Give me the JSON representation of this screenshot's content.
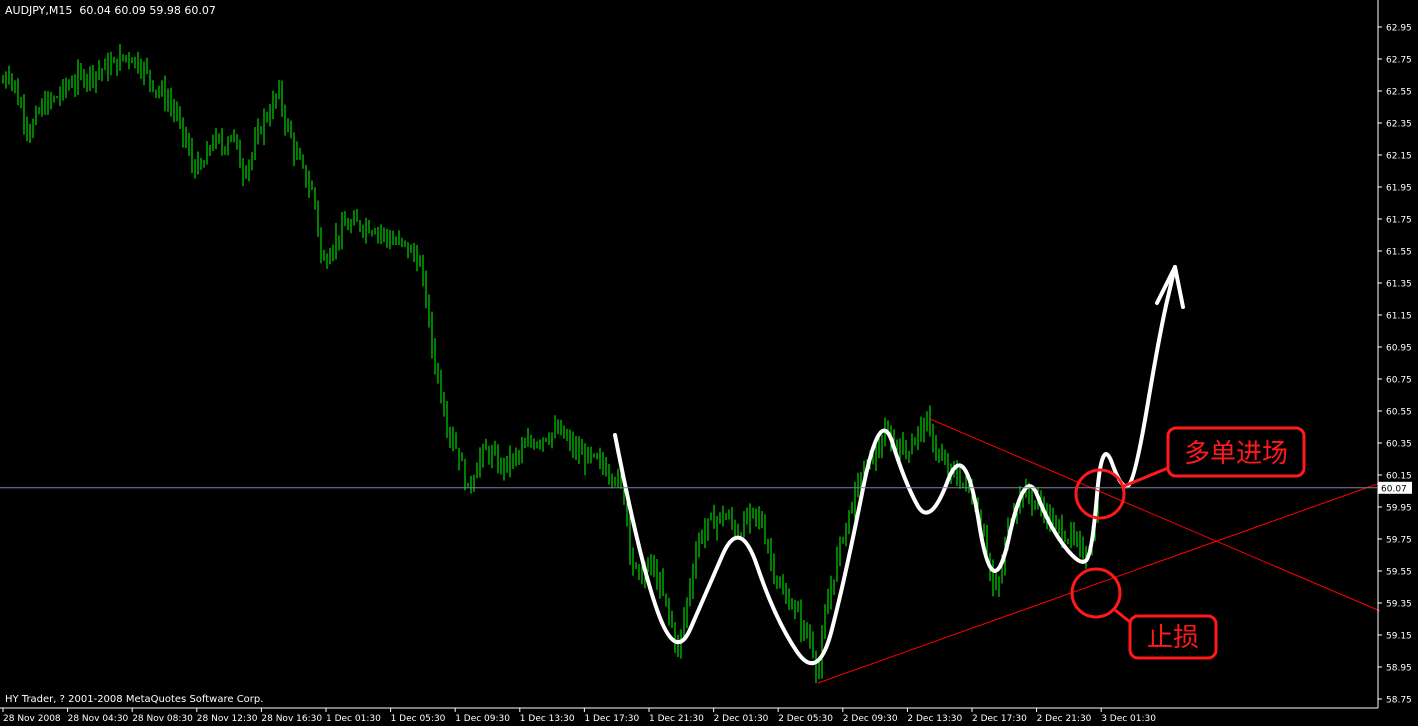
{
  "header": {
    "symbol": "AUDJPY,M15",
    "ohlc": "60.04 60.09 59.98 60.07"
  },
  "footer": {
    "copyright": "HY Trader, ? 2001-2008 MetaQuotes Software Corp."
  },
  "annotations": {
    "long_entry": "多单进场",
    "stop_loss": "止损"
  },
  "colors": {
    "background": "#000000",
    "candles": "#00ff00",
    "axis": "#ffffff",
    "price_line": "#8080a0",
    "trendlines": "#ff0000",
    "annotation_red": "#ff1a1a",
    "pattern": "#ffffff"
  },
  "chart_data": {
    "type": "candlestick",
    "symbol": "AUDJPY",
    "timeframe": "M15",
    "current_price": "60.07",
    "y_ticks": [
      "62.95",
      "62.75",
      "62.55",
      "62.35",
      "62.15",
      "61.95",
      "61.75",
      "61.55",
      "61.35",
      "61.15",
      "60.95",
      "60.75",
      "60.55",
      "60.35",
      "60.15",
      "59.95",
      "59.75",
      "59.55",
      "59.35",
      "59.15",
      "58.95",
      "58.75"
    ],
    "x_ticks": [
      "28 Nov 2008",
      "28 Nov 04:30",
      "28 Nov 08:30",
      "28 Nov 12:30",
      "28 Nov 16:30",
      "1 Dec 01:30",
      "1 Dec 05:30",
      "1 Dec 09:30",
      "1 Dec 13:30",
      "1 Dec 17:30",
      "1 Dec 21:30",
      "2 Dec 01:30",
      "2 Dec 05:30",
      "2 Dec 09:30",
      "2 Dec 13:30",
      "2 Dec 17:30",
      "2 Dec 21:30",
      "3 Dec 01:30"
    ],
    "ylim": [
      58.75,
      62.95
    ],
    "price_path": [
      [
        0,
        62.55
      ],
      [
        8,
        62.7
      ],
      [
        18,
        62.5
      ],
      [
        30,
        62.3
      ],
      [
        42,
        62.45
      ],
      [
        55,
        62.5
      ],
      [
        70,
        62.6
      ],
      [
        85,
        62.65
      ],
      [
        100,
        62.68
      ],
      [
        115,
        62.72
      ],
      [
        128,
        62.78
      ],
      [
        140,
        62.72
      ],
      [
        155,
        62.58
      ],
      [
        170,
        62.48
      ],
      [
        182,
        62.3
      ],
      [
        192,
        62.1
      ],
      [
        202,
        62.05
      ],
      [
        212,
        62.25
      ],
      [
        222,
        62.2
      ],
      [
        232,
        62.3
      ],
      [
        242,
        62.05
      ],
      [
        252,
        62.15
      ],
      [
        262,
        62.35
      ],
      [
        272,
        62.45
      ],
      [
        278,
        62.55
      ],
      [
        286,
        62.35
      ],
      [
        296,
        62.15
      ],
      [
        306,
        62.0
      ],
      [
        314,
        61.9
      ],
      [
        318,
        61.7
      ],
      [
        322,
        61.45
      ],
      [
        332,
        61.6
      ],
      [
        345,
        61.7
      ],
      [
        360,
        61.72
      ],
      [
        375,
        61.7
      ],
      [
        390,
        61.62
      ],
      [
        405,
        61.58
      ],
      [
        418,
        61.5
      ],
      [
        425,
        61.3
      ],
      [
        432,
        60.95
      ],
      [
        440,
        60.7
      ],
      [
        448,
        60.45
      ],
      [
        458,
        60.3
      ],
      [
        468,
        60.05
      ],
      [
        478,
        60.25
      ],
      [
        488,
        60.3
      ],
      [
        500,
        60.2
      ],
      [
        515,
        60.25
      ],
      [
        530,
        60.35
      ],
      [
        545,
        60.4
      ],
      [
        560,
        60.42
      ],
      [
        575,
        60.3
      ],
      [
        590,
        60.25
      ],
      [
        605,
        60.2
      ],
      [
        615,
        60.15
      ],
      [
        625,
        60.0
      ],
      [
        632,
        59.6
      ],
      [
        640,
        59.5
      ],
      [
        650,
        59.6
      ],
      [
        660,
        59.45
      ],
      [
        670,
        59.25
      ],
      [
        678,
        59.05
      ],
      [
        688,
        59.4
      ],
      [
        698,
        59.75
      ],
      [
        710,
        59.85
      ],
      [
        725,
        59.9
      ],
      [
        738,
        59.8
      ],
      [
        752,
        59.9
      ],
      [
        762,
        59.85
      ],
      [
        772,
        59.6
      ],
      [
        782,
        59.4
      ],
      [
        792,
        59.35
      ],
      [
        802,
        59.2
      ],
      [
        812,
        59.1
      ],
      [
        818,
        58.9
      ],
      [
        826,
        59.3
      ],
      [
        836,
        59.6
      ],
      [
        846,
        59.85
      ],
      [
        856,
        60.05
      ],
      [
        866,
        60.2
      ],
      [
        876,
        60.3
      ],
      [
        886,
        60.4
      ],
      [
        896,
        60.35
      ],
      [
        906,
        60.3
      ],
      [
        916,
        60.4
      ],
      [
        926,
        60.48
      ],
      [
        934,
        60.35
      ],
      [
        944,
        60.2
      ],
      [
        954,
        60.15
      ],
      [
        964,
        60.1
      ],
      [
        974,
        60.0
      ],
      [
        984,
        59.8
      ],
      [
        994,
        59.4
      ],
      [
        1000,
        59.5
      ],
      [
        1010,
        59.9
      ],
      [
        1022,
        60.05
      ],
      [
        1032,
        60.0
      ],
      [
        1042,
        59.95
      ],
      [
        1052,
        59.85
      ],
      [
        1062,
        59.8
      ],
      [
        1072,
        59.75
      ],
      [
        1082,
        59.65
      ],
      [
        1092,
        59.75
      ],
      [
        1098,
        60.07
      ]
    ],
    "pattern_path": [
      [
        615,
        60.4
      ],
      [
        640,
        59.6
      ],
      [
        676,
        58.98
      ],
      [
        705,
        59.4
      ],
      [
        740,
        59.9
      ],
      [
        775,
        59.25
      ],
      [
        818,
        58.85
      ],
      [
        845,
        59.5
      ],
      [
        880,
        60.6
      ],
      [
        905,
        60.1
      ],
      [
        930,
        59.82
      ],
      [
        965,
        60.4
      ],
      [
        993,
        59.3
      ],
      [
        1025,
        60.22
      ],
      [
        1050,
        59.82
      ],
      [
        1080,
        59.58
      ],
      [
        1092,
        59.65
      ],
      [
        1102,
        60.4
      ],
      [
        1122,
        60.05
      ],
      [
        1135,
        60.12
      ],
      [
        1160,
        61.05
      ],
      [
        1175,
        61.45
      ]
    ],
    "price_line": 60.07,
    "trendlines": [
      {
        "name": "upper",
        "from": [
          930,
          60.5
        ],
        "to": [
          1380,
          59.3
        ]
      },
      {
        "name": "lower",
        "from": [
          818,
          58.85
        ],
        "to": [
          1380,
          60.1
        ]
      }
    ]
  }
}
